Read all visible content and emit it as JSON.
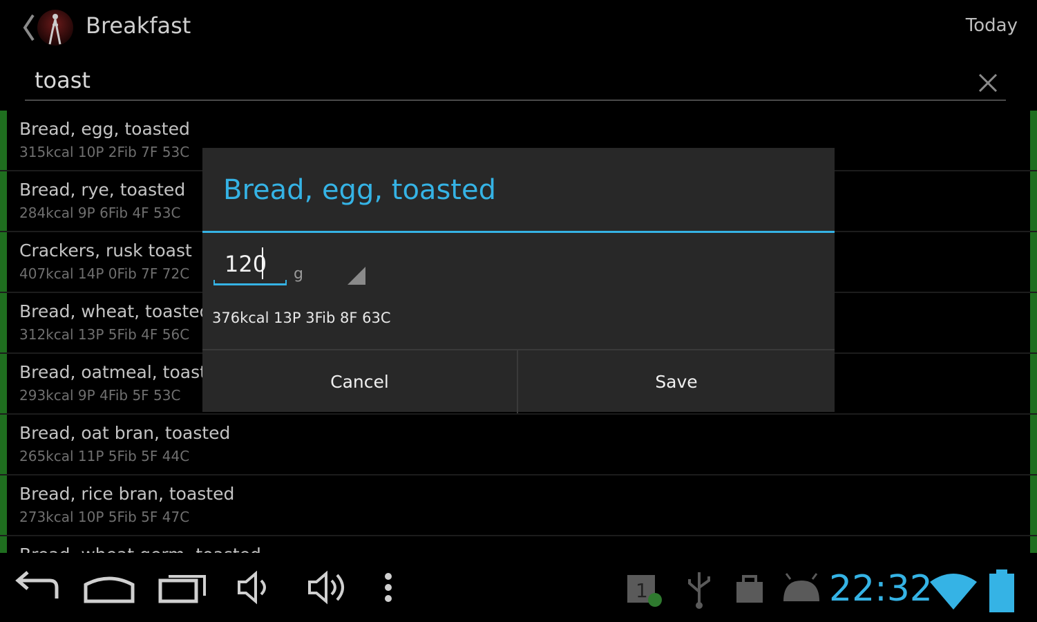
{
  "actionbar": {
    "title": "Breakfast",
    "date_label": "Today",
    "icons": [
      "chevron-left-icon",
      "app-logo-icon"
    ]
  },
  "search": {
    "value": "toast",
    "clear_icon": "close-icon"
  },
  "results": [
    {
      "name": "Bread, egg, toasted",
      "info": "315kcal 10P 2Fib 7F 53C"
    },
    {
      "name": "Bread, rye, toasted",
      "info": "284kcal 9P 6Fib 4F 53C"
    },
    {
      "name": "Crackers, rusk toast",
      "info": "407kcal 14P 0Fib 7F 72C"
    },
    {
      "name": "Bread, wheat, toasted",
      "info": "312kcal 13P 5Fib 4F 56C"
    },
    {
      "name": "Bread, oatmeal, toasted",
      "info": "293kcal 9P 4Fib 5F 53C"
    },
    {
      "name": "Bread, oat bran, toasted",
      "info": "265kcal 11P 5Fib 5F 44C"
    },
    {
      "name": "Bread, rice bran, toasted",
      "info": "273kcal 10P 5Fib 5F 47C"
    },
    {
      "name": "Bread, wheat germ, toasted",
      "info": ""
    }
  ],
  "dialog": {
    "title": "Bread, egg, toasted",
    "amount": "120",
    "unit": "g",
    "nutrition": "376kcal 13P 3Fib 8F 63C",
    "cancel_label": "Cancel",
    "save_label": "Save"
  },
  "systembar": {
    "time": "22:32",
    "nav_icons": [
      "back-icon",
      "home-icon",
      "recent-apps-icon",
      "volume-down-icon",
      "volume-up-icon",
      "menu-icon"
    ],
    "status_icons": [
      "calendar-notification-icon",
      "usb-icon",
      "shopping-bag-icon",
      "android-debug-icon",
      "wifi-icon",
      "battery-icon"
    ]
  },
  "colors": {
    "accent": "#35b3e5",
    "list_marker": "#1f6e1f",
    "dialog_bg": "#282828"
  }
}
